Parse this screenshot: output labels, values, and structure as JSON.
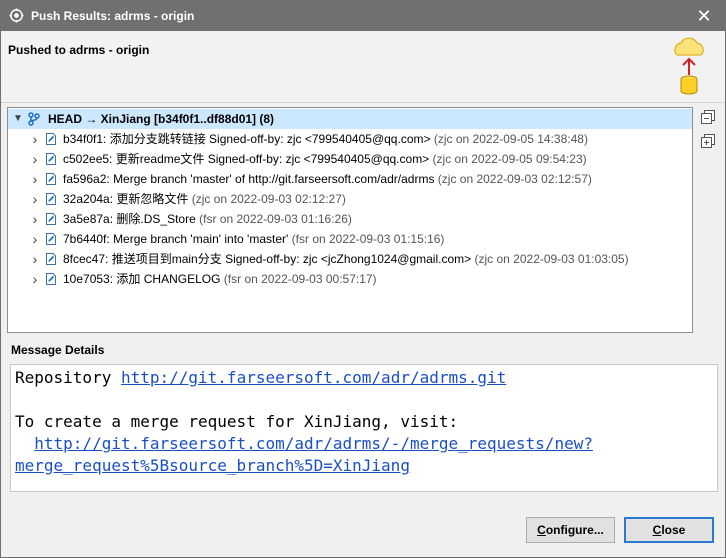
{
  "window": {
    "title": "Push Results: adrms - origin",
    "close_glyph": "✕"
  },
  "header": {
    "heading": "Pushed to adrms - origin"
  },
  "tree": {
    "root": {
      "label": "HEAD → XinJiang [b34f0f1..df88d01] (8)"
    },
    "commits": [
      {
        "sha": "b34f0f1:",
        "message": "添加分支跳转链接 Signed-off-by: zjc <799540405@qq.com>",
        "meta": "(zjc on 2022-09-05 14:38:48)"
      },
      {
        "sha": "c502ee5:",
        "message": "更新readme文件 Signed-off-by: zjc <799540405@qq.com>",
        "meta": "(zjc on 2022-09-05 09:54:23)"
      },
      {
        "sha": "fa596a2:",
        "message": "Merge branch 'master' of http://git.farseersoft.com/adr/adrms",
        "meta": "(zjc on 2022-09-03 02:12:57)"
      },
      {
        "sha": "32a204a:",
        "message": "更新忽略文件",
        "meta": "(zjc on 2022-09-03 02:12:27)"
      },
      {
        "sha": "3a5e87a:",
        "message": "删除.DS_Store",
        "meta": "(fsr on 2022-09-03 01:16:26)"
      },
      {
        "sha": "7b6440f:",
        "message": "Merge branch 'main' into 'master'",
        "meta": "(fsr on 2022-09-03 01:15:16)"
      },
      {
        "sha": "8fcec47:",
        "message": "推送项目到main分支 Signed-off-by: zjc <jcZhong1024@gmail.com>",
        "meta": "(zjc on 2022-09-03 01:03:05)"
      },
      {
        "sha": "10e7053:",
        "message": "添加 CHANGELOG",
        "meta": "(fsr on 2022-09-03 00:57:17)"
      }
    ]
  },
  "details": {
    "label": "Message Details",
    "repo_prefix": "Repository ",
    "repo_url": "http://git.farseersoft.com/adr/adrms.git",
    "mr_intro": "To create a merge request for XinJiang, visit:",
    "mr_url_line1": "http://git.farseersoft.com/adr/adrms/-/merge_requests/new?",
    "mr_url_line2": "merge_request%5Bsource_branch%5D=XinJiang"
  },
  "buttons": {
    "configure_label": "Configure...",
    "close_label": "Close"
  },
  "colors": {
    "titlebar": "#707070",
    "selection": "#cce8ff",
    "link": "#1a4fc4",
    "default_button_border": "#2a7ad2"
  },
  "icons": {
    "app": "eclipse-icon",
    "branch": "branch-icon",
    "commit": "commit-icon",
    "banner": "push-to-cloud-icon",
    "collapse": "collapse-all-icon",
    "expand": "expand-all-icon"
  }
}
